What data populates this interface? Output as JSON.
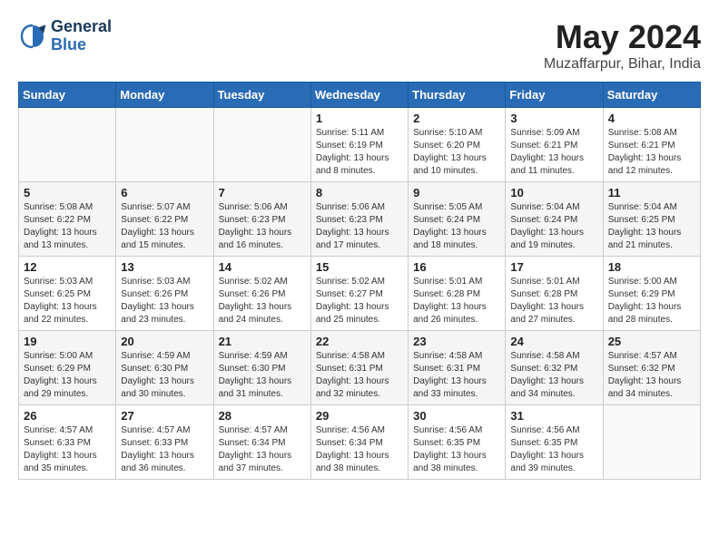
{
  "header": {
    "logo_line1": "General",
    "logo_line2": "Blue",
    "month": "May 2024",
    "location": "Muzaffarpur, Bihar, India"
  },
  "weekdays": [
    "Sunday",
    "Monday",
    "Tuesday",
    "Wednesday",
    "Thursday",
    "Friday",
    "Saturday"
  ],
  "weeks": [
    [
      {
        "day": "",
        "sunrise": "",
        "sunset": "",
        "daylight": ""
      },
      {
        "day": "",
        "sunrise": "",
        "sunset": "",
        "daylight": ""
      },
      {
        "day": "",
        "sunrise": "",
        "sunset": "",
        "daylight": ""
      },
      {
        "day": "1",
        "sunrise": "Sunrise: 5:11 AM",
        "sunset": "Sunset: 6:19 PM",
        "daylight": "Daylight: 13 hours and 8 minutes."
      },
      {
        "day": "2",
        "sunrise": "Sunrise: 5:10 AM",
        "sunset": "Sunset: 6:20 PM",
        "daylight": "Daylight: 13 hours and 10 minutes."
      },
      {
        "day": "3",
        "sunrise": "Sunrise: 5:09 AM",
        "sunset": "Sunset: 6:21 PM",
        "daylight": "Daylight: 13 hours and 11 minutes."
      },
      {
        "day": "4",
        "sunrise": "Sunrise: 5:08 AM",
        "sunset": "Sunset: 6:21 PM",
        "daylight": "Daylight: 13 hours and 12 minutes."
      }
    ],
    [
      {
        "day": "5",
        "sunrise": "Sunrise: 5:08 AM",
        "sunset": "Sunset: 6:22 PM",
        "daylight": "Daylight: 13 hours and 13 minutes."
      },
      {
        "day": "6",
        "sunrise": "Sunrise: 5:07 AM",
        "sunset": "Sunset: 6:22 PM",
        "daylight": "Daylight: 13 hours and 15 minutes."
      },
      {
        "day": "7",
        "sunrise": "Sunrise: 5:06 AM",
        "sunset": "Sunset: 6:23 PM",
        "daylight": "Daylight: 13 hours and 16 minutes."
      },
      {
        "day": "8",
        "sunrise": "Sunrise: 5:06 AM",
        "sunset": "Sunset: 6:23 PM",
        "daylight": "Daylight: 13 hours and 17 minutes."
      },
      {
        "day": "9",
        "sunrise": "Sunrise: 5:05 AM",
        "sunset": "Sunset: 6:24 PM",
        "daylight": "Daylight: 13 hours and 18 minutes."
      },
      {
        "day": "10",
        "sunrise": "Sunrise: 5:04 AM",
        "sunset": "Sunset: 6:24 PM",
        "daylight": "Daylight: 13 hours and 19 minutes."
      },
      {
        "day": "11",
        "sunrise": "Sunrise: 5:04 AM",
        "sunset": "Sunset: 6:25 PM",
        "daylight": "Daylight: 13 hours and 21 minutes."
      }
    ],
    [
      {
        "day": "12",
        "sunrise": "Sunrise: 5:03 AM",
        "sunset": "Sunset: 6:25 PM",
        "daylight": "Daylight: 13 hours and 22 minutes."
      },
      {
        "day": "13",
        "sunrise": "Sunrise: 5:03 AM",
        "sunset": "Sunset: 6:26 PM",
        "daylight": "Daylight: 13 hours and 23 minutes."
      },
      {
        "day": "14",
        "sunrise": "Sunrise: 5:02 AM",
        "sunset": "Sunset: 6:26 PM",
        "daylight": "Daylight: 13 hours and 24 minutes."
      },
      {
        "day": "15",
        "sunrise": "Sunrise: 5:02 AM",
        "sunset": "Sunset: 6:27 PM",
        "daylight": "Daylight: 13 hours and 25 minutes."
      },
      {
        "day": "16",
        "sunrise": "Sunrise: 5:01 AM",
        "sunset": "Sunset: 6:28 PM",
        "daylight": "Daylight: 13 hours and 26 minutes."
      },
      {
        "day": "17",
        "sunrise": "Sunrise: 5:01 AM",
        "sunset": "Sunset: 6:28 PM",
        "daylight": "Daylight: 13 hours and 27 minutes."
      },
      {
        "day": "18",
        "sunrise": "Sunrise: 5:00 AM",
        "sunset": "Sunset: 6:29 PM",
        "daylight": "Daylight: 13 hours and 28 minutes."
      }
    ],
    [
      {
        "day": "19",
        "sunrise": "Sunrise: 5:00 AM",
        "sunset": "Sunset: 6:29 PM",
        "daylight": "Daylight: 13 hours and 29 minutes."
      },
      {
        "day": "20",
        "sunrise": "Sunrise: 4:59 AM",
        "sunset": "Sunset: 6:30 PM",
        "daylight": "Daylight: 13 hours and 30 minutes."
      },
      {
        "day": "21",
        "sunrise": "Sunrise: 4:59 AM",
        "sunset": "Sunset: 6:30 PM",
        "daylight": "Daylight: 13 hours and 31 minutes."
      },
      {
        "day": "22",
        "sunrise": "Sunrise: 4:58 AM",
        "sunset": "Sunset: 6:31 PM",
        "daylight": "Daylight: 13 hours and 32 minutes."
      },
      {
        "day": "23",
        "sunrise": "Sunrise: 4:58 AM",
        "sunset": "Sunset: 6:31 PM",
        "daylight": "Daylight: 13 hours and 33 minutes."
      },
      {
        "day": "24",
        "sunrise": "Sunrise: 4:58 AM",
        "sunset": "Sunset: 6:32 PM",
        "daylight": "Daylight: 13 hours and 34 minutes."
      },
      {
        "day": "25",
        "sunrise": "Sunrise: 4:57 AM",
        "sunset": "Sunset: 6:32 PM",
        "daylight": "Daylight: 13 hours and 34 minutes."
      }
    ],
    [
      {
        "day": "26",
        "sunrise": "Sunrise: 4:57 AM",
        "sunset": "Sunset: 6:33 PM",
        "daylight": "Daylight: 13 hours and 35 minutes."
      },
      {
        "day": "27",
        "sunrise": "Sunrise: 4:57 AM",
        "sunset": "Sunset: 6:33 PM",
        "daylight": "Daylight: 13 hours and 36 minutes."
      },
      {
        "day": "28",
        "sunrise": "Sunrise: 4:57 AM",
        "sunset": "Sunset: 6:34 PM",
        "daylight": "Daylight: 13 hours and 37 minutes."
      },
      {
        "day": "29",
        "sunrise": "Sunrise: 4:56 AM",
        "sunset": "Sunset: 6:34 PM",
        "daylight": "Daylight: 13 hours and 38 minutes."
      },
      {
        "day": "30",
        "sunrise": "Sunrise: 4:56 AM",
        "sunset": "Sunset: 6:35 PM",
        "daylight": "Daylight: 13 hours and 38 minutes."
      },
      {
        "day": "31",
        "sunrise": "Sunrise: 4:56 AM",
        "sunset": "Sunset: 6:35 PM",
        "daylight": "Daylight: 13 hours and 39 minutes."
      },
      {
        "day": "",
        "sunrise": "",
        "sunset": "",
        "daylight": ""
      }
    ]
  ]
}
